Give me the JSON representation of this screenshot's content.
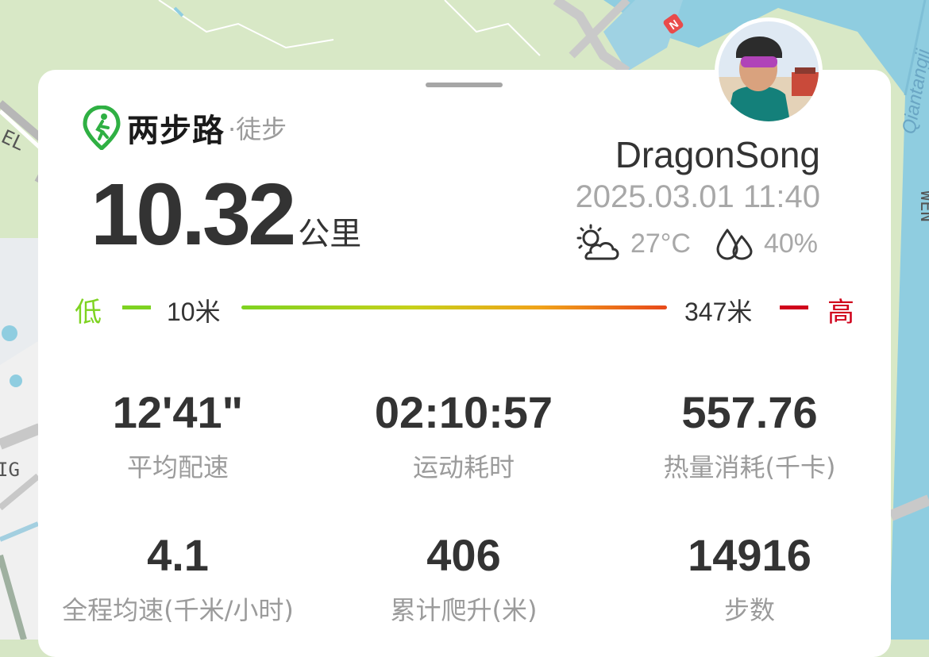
{
  "app": {
    "brand_name": "两步路",
    "mode": "·徒步",
    "accent": "#2fb043"
  },
  "summary": {
    "distance_value": "10.32",
    "distance_unit": "公里"
  },
  "user": {
    "name": "DragonSong",
    "datetime": "2025.03.01 11:40"
  },
  "weather": {
    "icon": "partly-cloudy-icon",
    "temperature": "27°C",
    "humidity_icon": "water-drops-icon",
    "humidity": "40%"
  },
  "elevation": {
    "low_label": "低",
    "low_value": "10米",
    "high_value": "347米",
    "high_label": "高",
    "low_color": "#7ed321",
    "high_color": "#d0021b"
  },
  "stats": [
    {
      "value": "12'41\"",
      "label": "平均配速"
    },
    {
      "value": "02:10:57",
      "label": "运动耗时"
    },
    {
      "value": "557.76",
      "label": "热量消耗(千卡)"
    },
    {
      "value": "4.1",
      "label": "全程均速(千米/小时)"
    },
    {
      "value": "406",
      "label": "累计爬升(米)"
    },
    {
      "value": "14916",
      "label": "步数"
    }
  ],
  "map": {
    "labels": [
      "EL",
      "IG",
      "Qiantangji",
      "WEN"
    ],
    "compass": "N"
  }
}
